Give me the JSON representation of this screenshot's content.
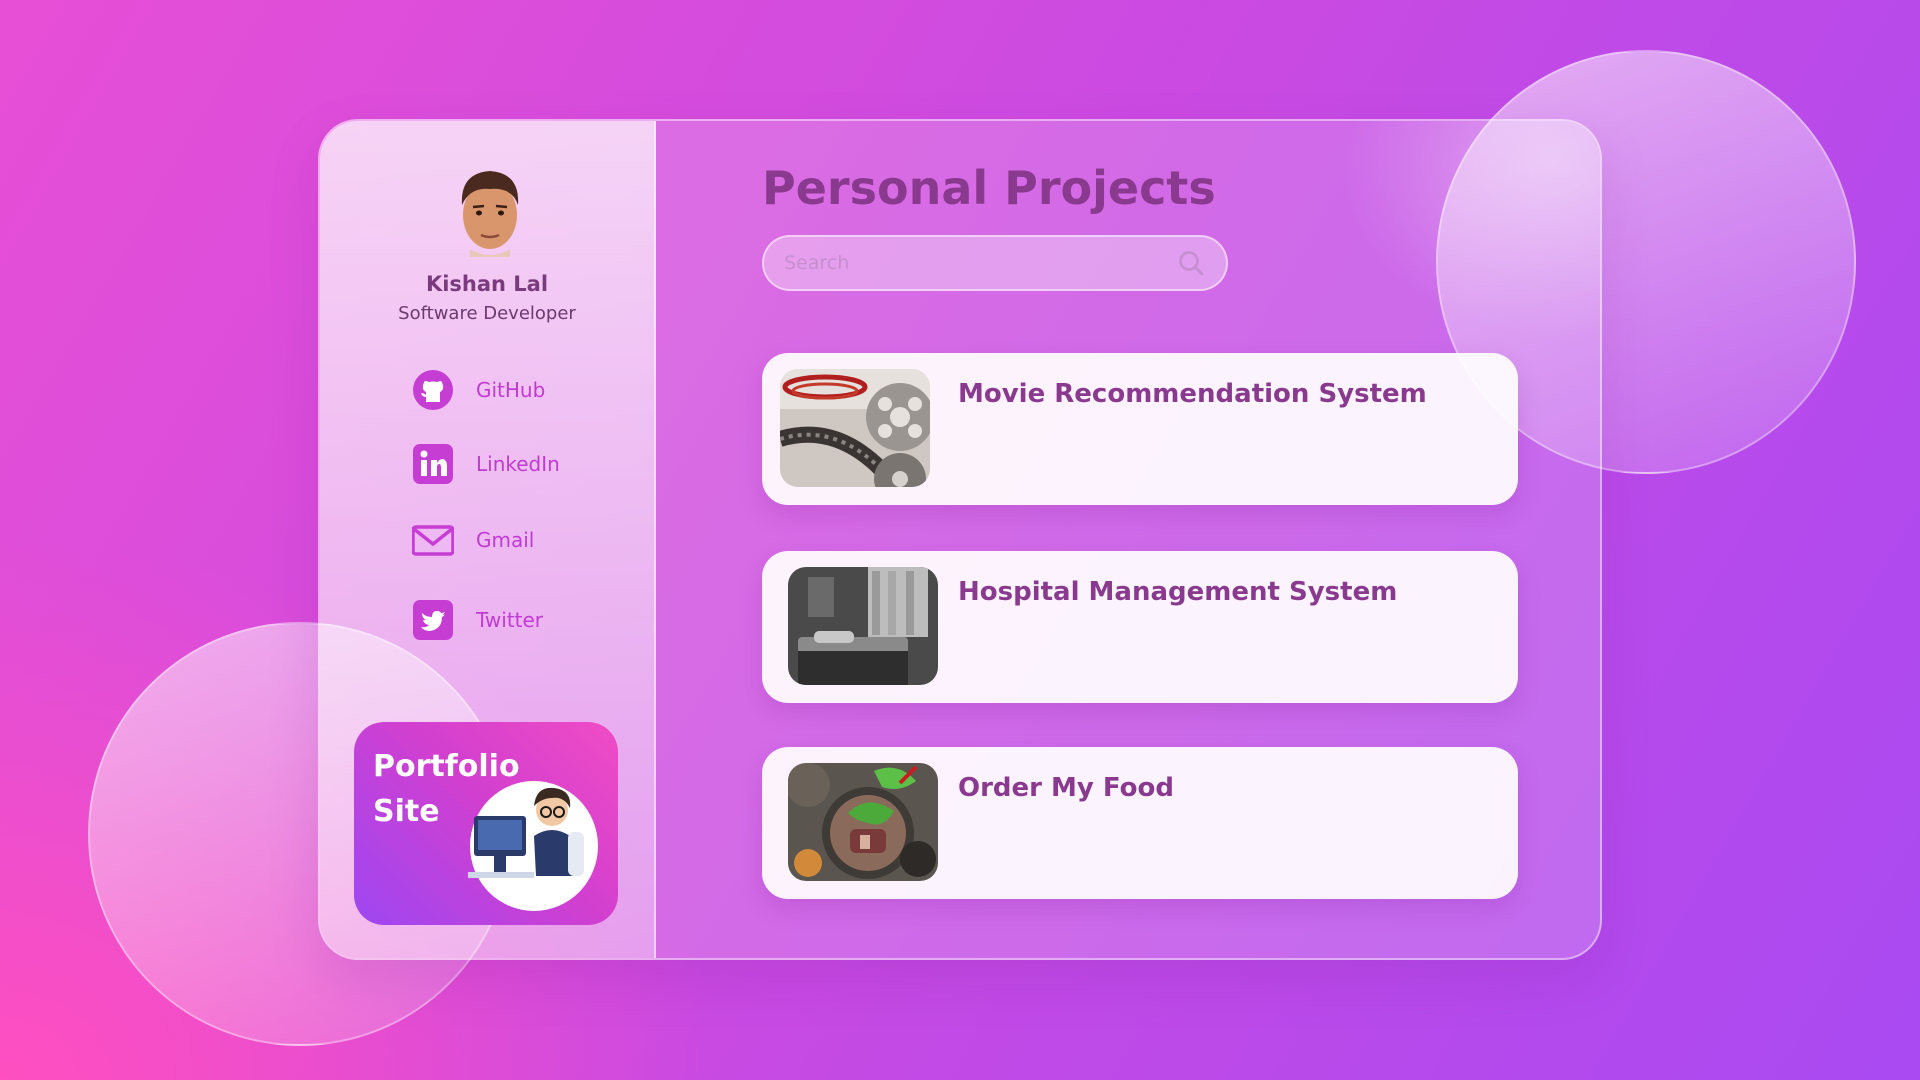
{
  "profile": {
    "name": "Kishan Lal",
    "role": "Software Developer"
  },
  "social": [
    {
      "label": "GitHub",
      "icon": "github-icon"
    },
    {
      "label": "LinkedIn",
      "icon": "linkedin-icon"
    },
    {
      "label": "Gmail",
      "icon": "gmail-icon"
    },
    {
      "label": "Twitter",
      "icon": "twitter-icon"
    }
  ],
  "portfolio": {
    "line1": "Portfolio",
    "line2": "Site"
  },
  "main": {
    "title": "Personal Projects",
    "search_placeholder": "Search"
  },
  "projects": [
    {
      "name": "Movie Recommendation System",
      "image": "film-reel-photo"
    },
    {
      "name": "Hospital Management System",
      "image": "hospital-room-photo"
    },
    {
      "name": "Order My Food",
      "image": "food-plate-photo"
    }
  ],
  "colors": {
    "accent": "#c03bd2",
    "title": "#8a3a8e",
    "gradient_start": "#e74fd6",
    "gradient_end": "#a94af2"
  }
}
